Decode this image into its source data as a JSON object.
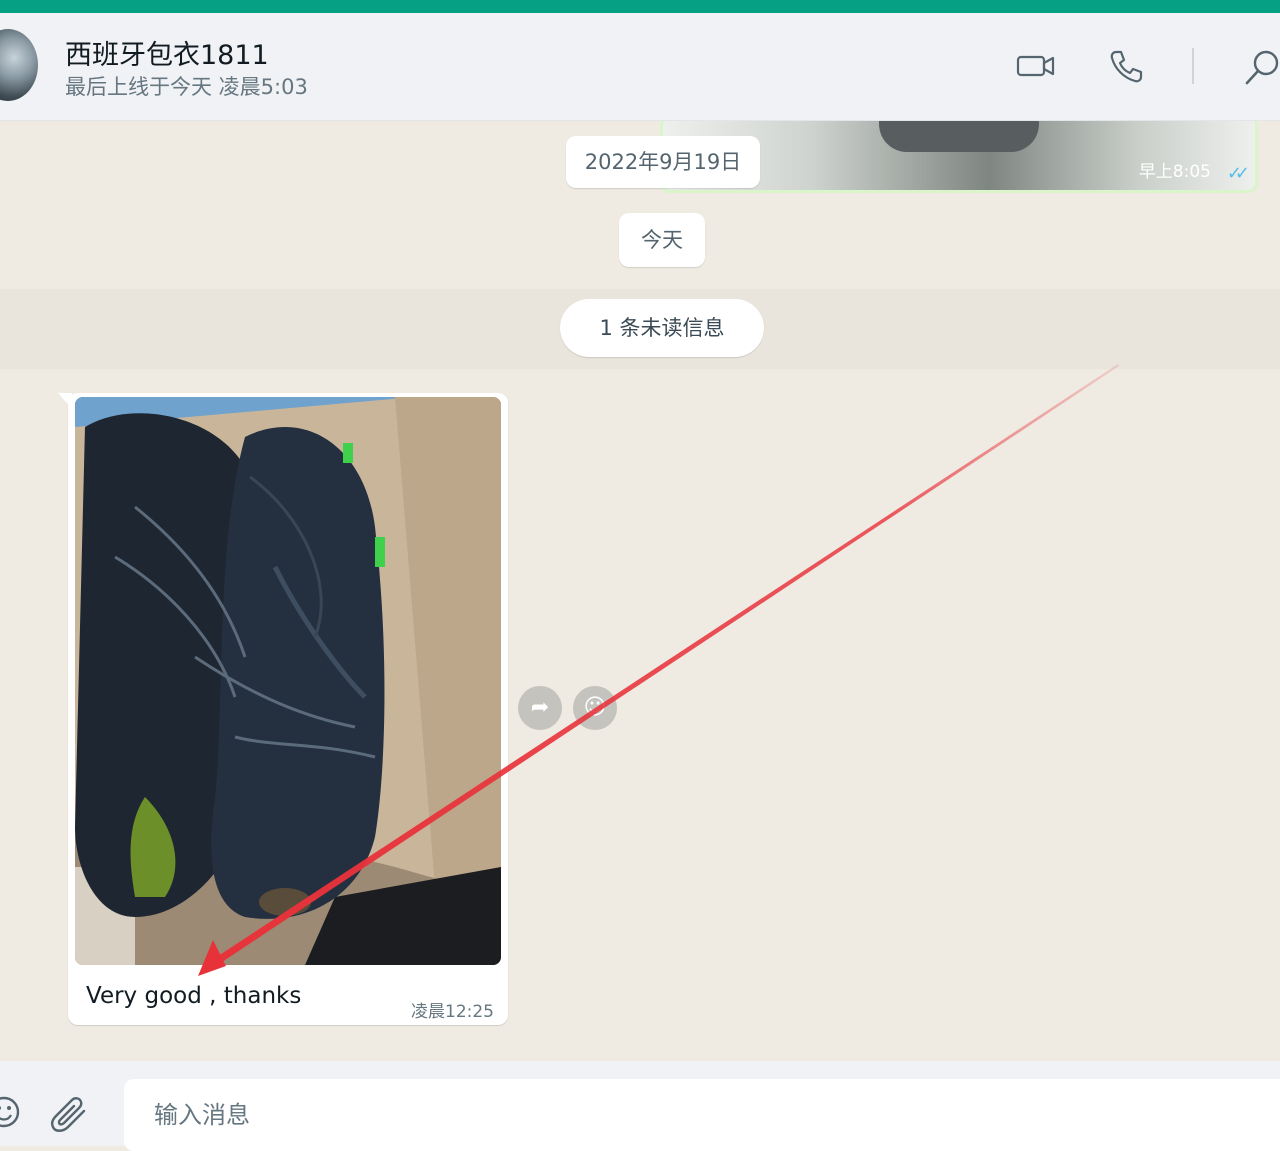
{
  "header": {
    "contact_name": "西班牙包衣1811",
    "status": "最后上线于今天 凌晨5:03",
    "icons": [
      "video-camera-icon",
      "phone-icon",
      "search-icon"
    ]
  },
  "chat": {
    "previous_message_time": "早上8:05",
    "date_separator": "2022年9月19日",
    "today_separator": "今天",
    "unread_banner": "1 条未读信息",
    "message": {
      "caption": "Very good , thanks",
      "time": "凌晨12:25",
      "image_subject": "black soccer cleats in cardboard box"
    },
    "message_actions": [
      "forward-icon",
      "emoji-reaction-icon"
    ]
  },
  "composer": {
    "placeholder": "输入消息",
    "icons": [
      "emoji-icon",
      "attach-icon"
    ]
  },
  "colors": {
    "top_bar": "#06a085",
    "chat_background": "#efeae2",
    "read_ticks": "#53bdeb",
    "annotation_arrow": "#e8323a"
  }
}
